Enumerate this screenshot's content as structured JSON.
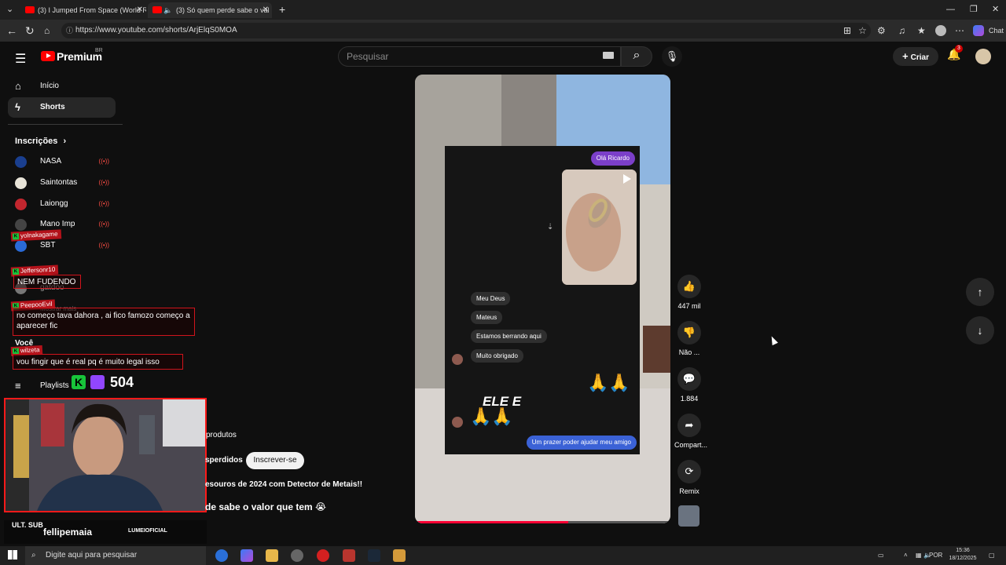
{
  "browser": {
    "tabs": [
      {
        "title": "(3) I Jumped From Space (World R"
      },
      {
        "title": "(3) Só quem perde sabe o val"
      }
    ],
    "url": "https://www.youtube.com/shorts/ArjElqS0MOA",
    "chat_label": "Chat"
  },
  "yt": {
    "brand": "Premium",
    "region": "BR",
    "search_placeholder": "Pesquisar",
    "create_label": "Criar",
    "notif_count": "3"
  },
  "sidebar": {
    "home": "Início",
    "shorts": "Shorts",
    "subs_title": "Inscrições",
    "subs": [
      {
        "name": "NASA",
        "color": "#1a3f8f"
      },
      {
        "name": "Saintontas",
        "color": "#e8e4d8"
      },
      {
        "name": "Laiongg",
        "color": "#c2262e"
      },
      {
        "name": "Mano Imp",
        "color": "#444444"
      },
      {
        "name": "SBT",
        "color": "#2a6ad6"
      },
      {
        "name": "gatdoo",
        "color": "#777777"
      }
    ],
    "show_more": "Mostrar mais",
    "you": "Você",
    "playlists": "Playlists"
  },
  "overlay": {
    "messages": [
      {
        "user": "yolnakagame",
        "text": ""
      },
      {
        "user": "Jeffersonr10",
        "text": "NEM FUDENDO"
      },
      {
        "user": "PeepooEvil",
        "text": "no começo tava dahora , ai fico famozo começo a aparecer fic"
      },
      {
        "user": "wilzeta",
        "text": "vou fingir que é real pq é muito legal isso"
      }
    ],
    "viewer_count": "504",
    "streamer": "fellipemaia",
    "sponsor": "LUMEIOFICIAL",
    "ult_label": "ULT. SUB"
  },
  "video": {
    "chat": {
      "greeting": "Olá Ricardo",
      "replies": [
        "Meu Deus",
        "Mateus",
        "Estamos berrando aqui",
        "Muito obrigado"
      ],
      "caption": "ELE E",
      "final": "Um prazer poder ajudar meu amigo"
    },
    "progress": 0.6
  },
  "actions": {
    "likes": "447 mil",
    "dislike": "Não ...",
    "comments": "1.884",
    "share": "Compart...",
    "remix": "Remix"
  },
  "below": {
    "products": "produtos",
    "channel_fragment": "sperdidos",
    "subscribe": "Inscrever-se",
    "video_desc": "esouros de 2024 com Detector de Metais!!",
    "title_fragment": "de sabe o valor que tem 😭"
  },
  "taskbar": {
    "search_placeholder": "Digite aqui para pesquisar",
    "lang": "POR",
    "time": "15:36",
    "date": "18/12/2025"
  }
}
